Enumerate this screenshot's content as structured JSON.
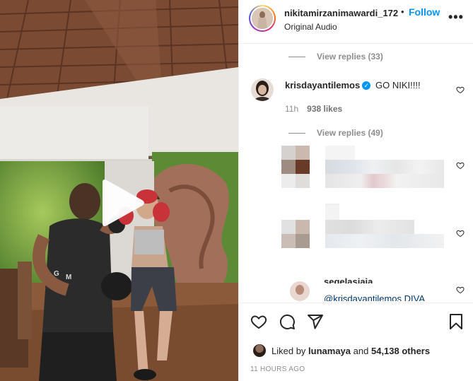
{
  "post": {
    "username": "nikitamirzanimawardi_172",
    "follow_label": "Follow",
    "separator": "•",
    "audio_label": "Original Audio",
    "more_label": "•••"
  },
  "comments": {
    "view_replies_top": "View replies (33)",
    "comment1": {
      "username": "krisdayantilemos",
      "verified_mark": "✓",
      "text": "GO NIKI!!!!",
      "time": "11h",
      "likes": "938 likes",
      "view_replies": "View replies (49)"
    },
    "partial_comment": {
      "username_fragment": "segelasjaja",
      "mention": "@krisdayantilemos DIVA"
    }
  },
  "footer": {
    "liked_by_prefix": "Liked by",
    "liked_by_user": "lunamaya",
    "and_label": "and",
    "others": "54,138 others",
    "timestamp": "11 HOURS AGO"
  },
  "icons": {
    "like": "heart-icon",
    "comment": "comment-icon",
    "share": "share-icon",
    "save": "bookmark-icon",
    "play": "play-icon",
    "more": "more-icon"
  }
}
